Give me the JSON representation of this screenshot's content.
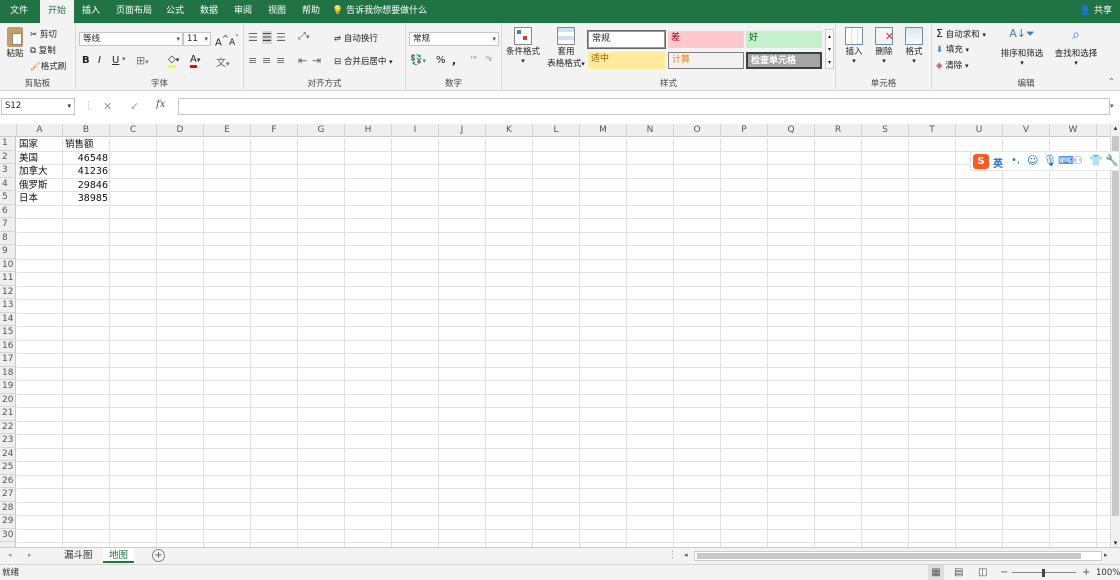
{
  "tabs": [
    "文件",
    "开始",
    "插入",
    "页面布局",
    "公式",
    "数据",
    "审阅",
    "视图",
    "帮助"
  ],
  "active_tab": "开始",
  "tell_me": "告诉我你想要做什么",
  "share": "共享",
  "clipboard": {
    "paste": "粘贴",
    "cut": "剪切",
    "copy": "复制",
    "format_painter": "格式刷",
    "label": "剪贴板"
  },
  "font": {
    "name": "等线",
    "size": "11",
    "label": "字体",
    "bold": "B",
    "italic": "I",
    "underline": "U",
    "grow": "A",
    "shrink": "A"
  },
  "alignment": {
    "wrap": "自动换行",
    "merge": "合并后居中",
    "label": "对齐方式"
  },
  "number": {
    "format": "常规",
    "label": "数字",
    "percent": "%",
    "comma": ","
  },
  "styles": {
    "conditional": "条件格式",
    "table_line1": "套用",
    "table_line2": "表格格式",
    "normal": "常规",
    "bad": "差",
    "good": "好",
    "neutral": "适中",
    "calc": "计算",
    "check": "检查单元格",
    "label": "样式"
  },
  "cells": {
    "insert": "插入",
    "delete": "删除",
    "format": "格式",
    "label": "单元格"
  },
  "editing": {
    "autosum": "自动求和",
    "fill": "填充",
    "clear": "清除",
    "sort": "排序和筛选",
    "find": "查找和选择",
    "label": "编辑"
  },
  "formula_bar": {
    "name_box": "S12",
    "cancel": "✕",
    "enter": "✓",
    "fx": "fx",
    "content": ""
  },
  "columns": [
    "A",
    "B",
    "C",
    "D",
    "E",
    "F",
    "G",
    "H",
    "I",
    "J",
    "K",
    "L",
    "M",
    "N",
    "O",
    "P",
    "Q",
    "R",
    "S",
    "T",
    "U",
    "V",
    "W"
  ],
  "rows": [
    "1",
    "2",
    "3",
    "4",
    "5",
    "6",
    "7",
    "8",
    "9",
    "10",
    "11",
    "12",
    "13",
    "14",
    "15",
    "16",
    "17",
    "18",
    "19",
    "20",
    "21",
    "22",
    "23",
    "24",
    "25",
    "26",
    "27",
    "28",
    "29",
    "30"
  ],
  "sheet_data": {
    "header": [
      "国家",
      "销售额"
    ],
    "rows": [
      [
        "美国",
        "46548"
      ],
      [
        "加拿大",
        "41236"
      ],
      [
        "俄罗斯",
        "29846"
      ],
      [
        "日本",
        "38985"
      ]
    ]
  },
  "ime": {
    "lang": "英",
    "punct": "•,"
  },
  "sheets": [
    "漏斗图",
    "地图"
  ],
  "active_sheet": "地图",
  "status": {
    "ready": "就绪",
    "zoom": "100%"
  },
  "colors": {
    "brand": "#217346",
    "bad_bg": "#ffc7ce",
    "bad_fg": "#9c0006",
    "good_bg": "#c6efce",
    "good_fg": "#006100",
    "neutral_bg": "#ffeb9c",
    "neutral_fg": "#9c5700",
    "check_bg": "#a5a5a5"
  }
}
